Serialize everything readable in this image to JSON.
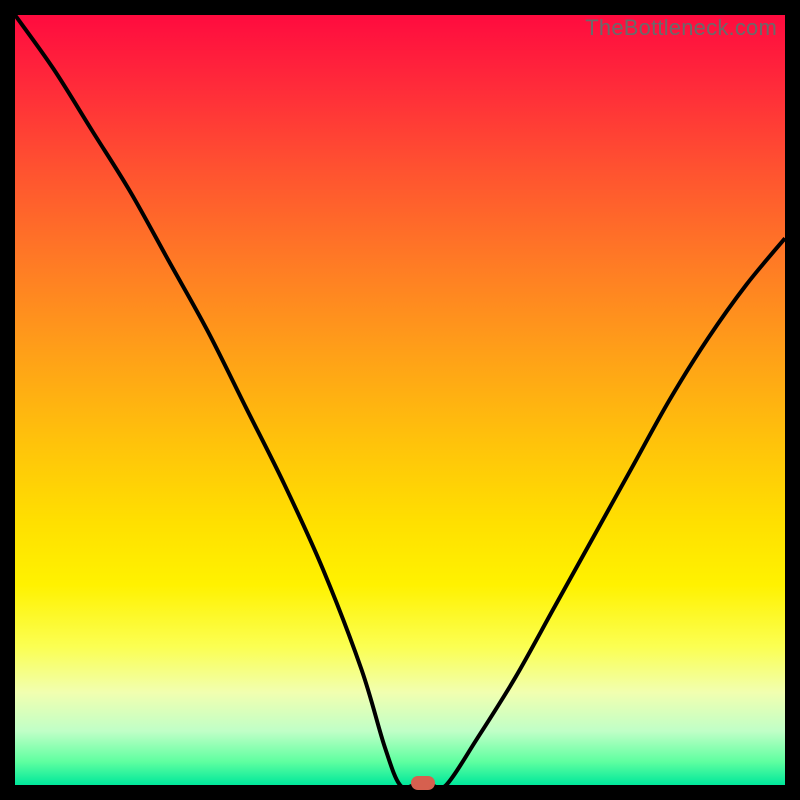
{
  "watermark": "TheBottleneck.com",
  "chart_data": {
    "type": "line",
    "title": "",
    "xlabel": "",
    "ylabel": "",
    "xlim": [
      0,
      100
    ],
    "ylim": [
      0,
      100
    ],
    "grid": false,
    "legend": false,
    "series": [
      {
        "name": "bottleneck-curve",
        "x": [
          0,
          5,
          10,
          15,
          20,
          25,
          30,
          35,
          40,
          45,
          48,
          50,
          52,
          54,
          56,
          60,
          65,
          70,
          75,
          80,
          85,
          90,
          95,
          100
        ],
        "values": [
          100,
          93,
          85,
          77,
          68,
          59,
          49,
          39,
          28,
          15,
          5,
          0,
          0,
          0,
          0,
          6,
          14,
          23,
          32,
          41,
          50,
          58,
          65,
          71
        ]
      }
    ],
    "annotations": [
      {
        "name": "optimal-point",
        "x": 53,
        "y": 0
      }
    ],
    "background_gradient": {
      "top": "#ff0b3f",
      "mid": "#ffe000",
      "bottom": "#00e89b"
    }
  },
  "marker_color": "#d6604f"
}
